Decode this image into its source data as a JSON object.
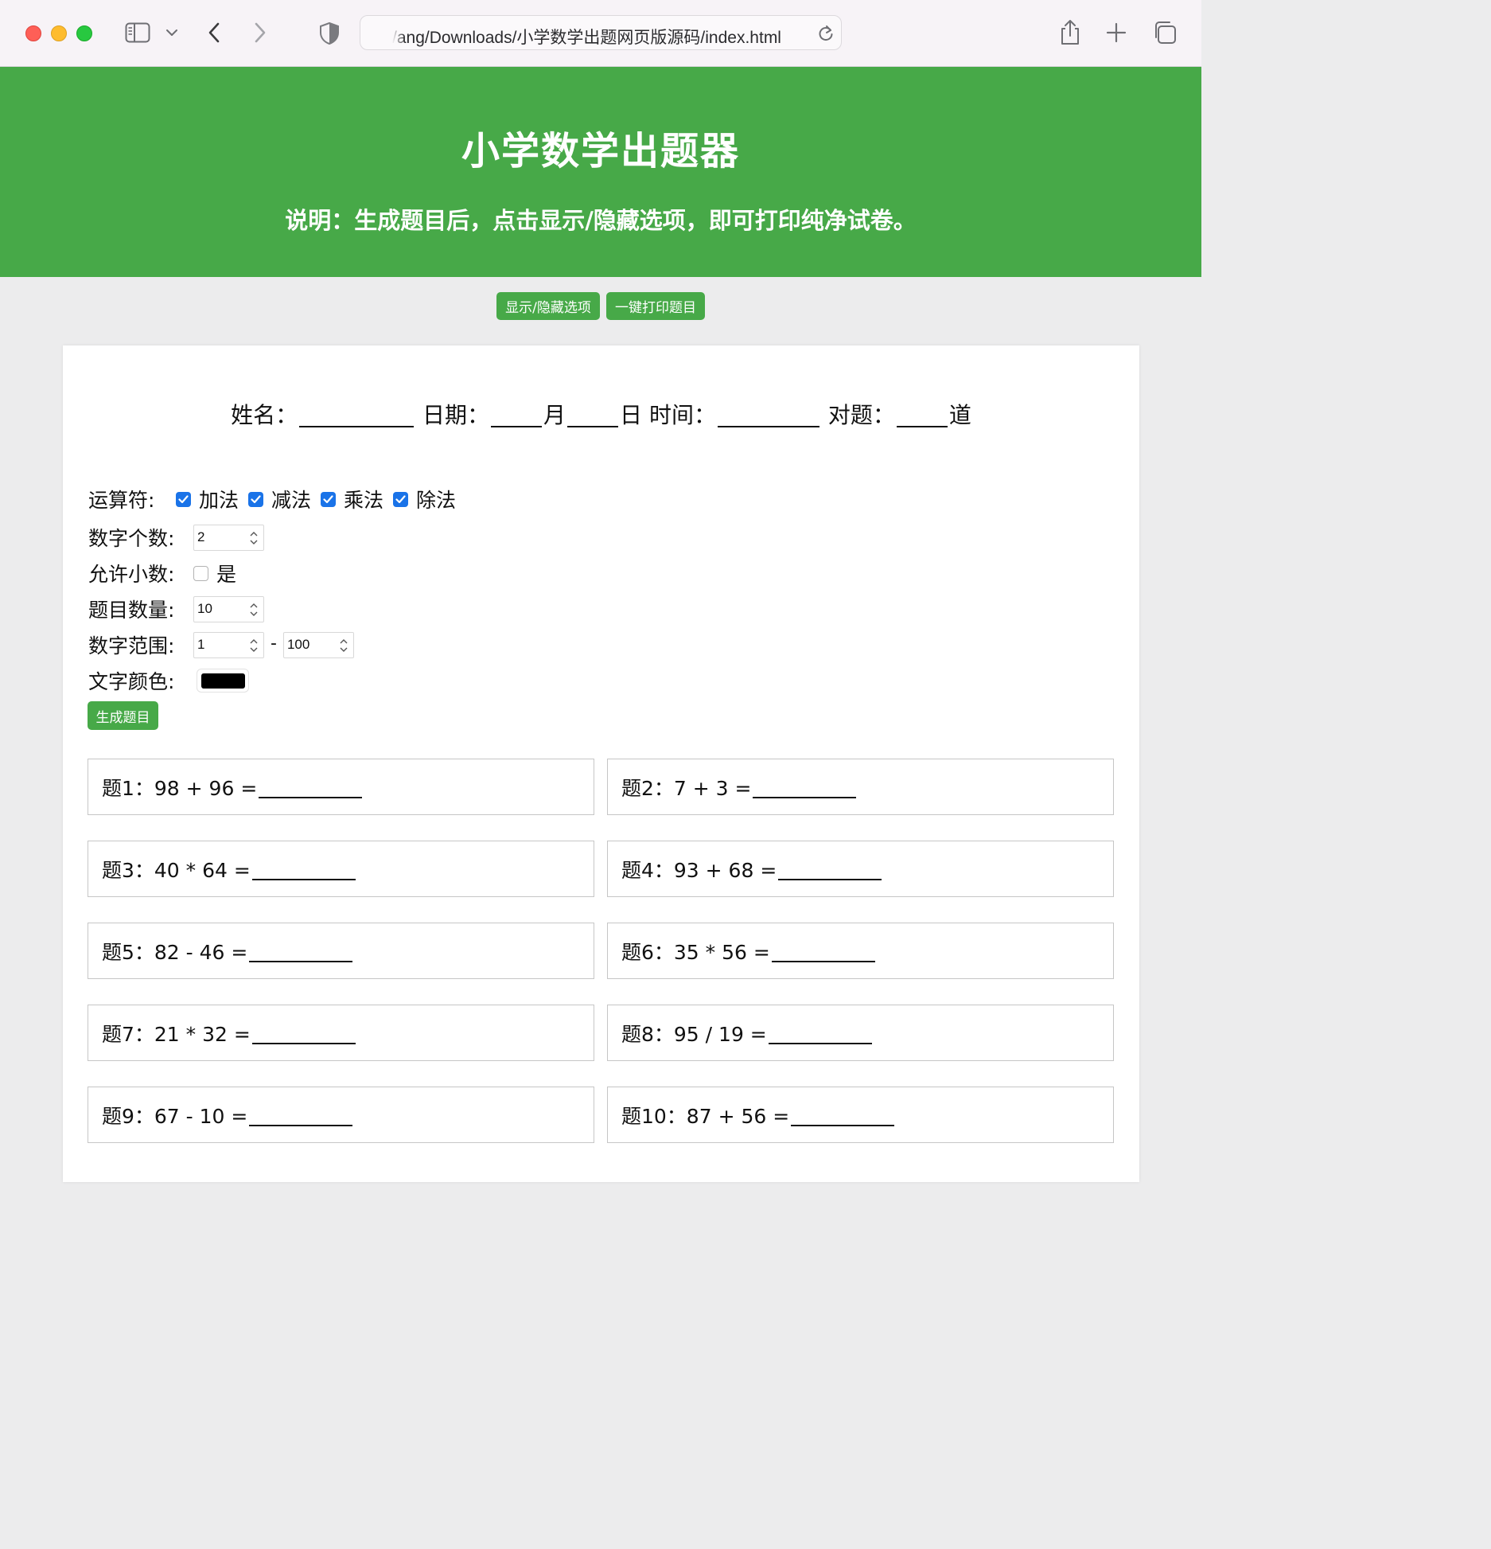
{
  "browser": {
    "url": "/ang/Downloads/小学数学出题网页版源码/index.html"
  },
  "header": {
    "title": "小学数学出题器",
    "subtitle": "说明：生成题目后，点击显示/隐藏选项，即可打印纯净试卷。"
  },
  "actions": {
    "toggle_label": "显示/隐藏选项",
    "print_label": "一键打印题目"
  },
  "info": {
    "name_label": "姓名：",
    "date_label": "日期：",
    "month": "月",
    "day": "日",
    "time_label": "时间：",
    "correct_label": "对题：",
    "unit": "道"
  },
  "options": {
    "operators_label": "运算符:",
    "operators": [
      "加法",
      "减法",
      "乘法",
      "除法"
    ],
    "count_label": "数字个数:",
    "count_value": "2",
    "decimal_label": "允许小数:",
    "decimal_option": "是",
    "quantity_label": "题目数量:",
    "quantity_value": "10",
    "range_label": "数字范围:",
    "range_min": "1",
    "range_sep": "-",
    "range_max": "100",
    "color_label": "文字颜色:",
    "text_color": "#000000",
    "generate_label": "生成题目"
  },
  "questions": [
    "题1：98 + 96 =",
    "题2：7 + 3 =",
    "题3：40 * 64 =",
    "题4：93 + 68 =",
    "题5：82 - 46 =",
    "题6：35 * 56 =",
    "题7：21 * 32 =",
    "题8：95 / 19 =",
    "题9：67 - 10 =",
    "题10：87 + 56 ="
  ],
  "colors": {
    "brand_green": "#47a948",
    "checkbox_blue": "#1a73e8"
  }
}
